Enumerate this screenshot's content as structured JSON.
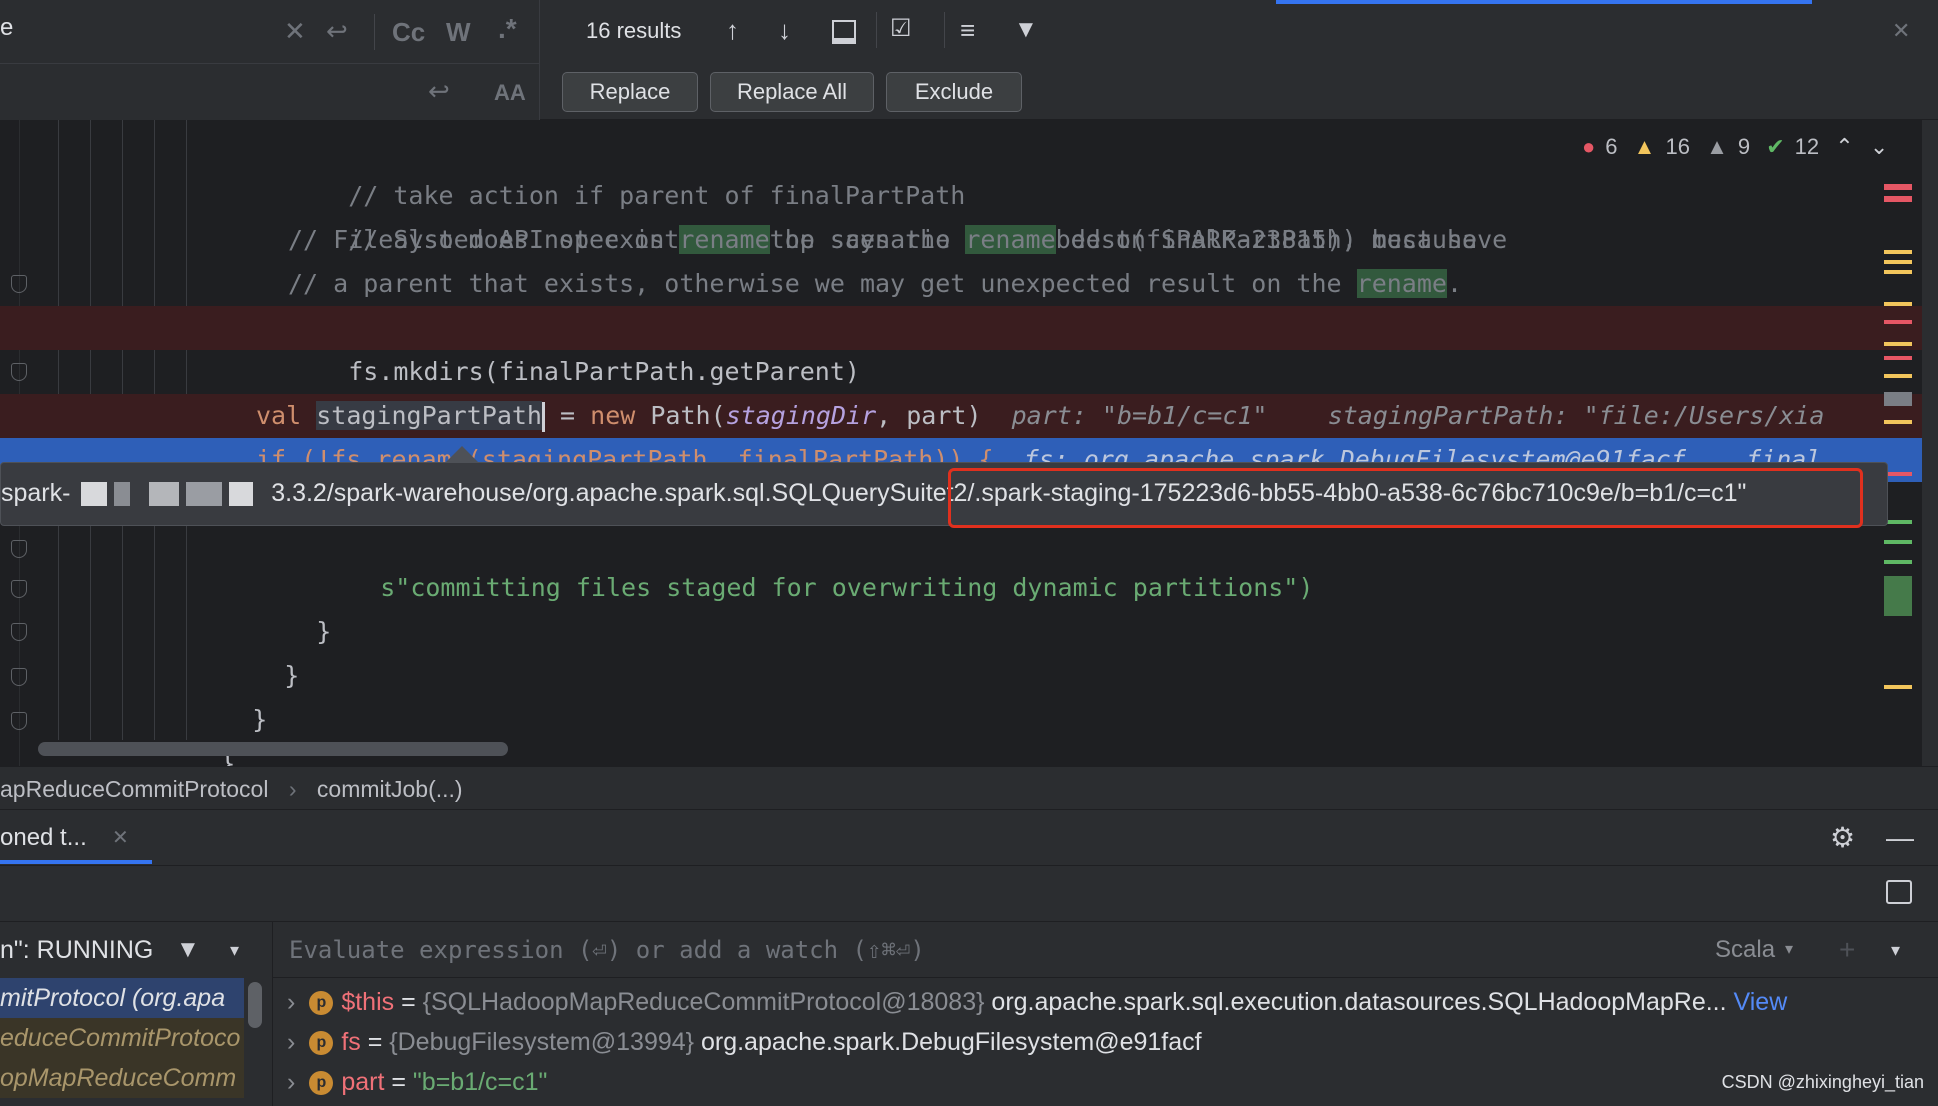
{
  "findbar": {
    "results": "16 results",
    "replace_label": "Replace",
    "replace_all_label": "Replace All",
    "exclude_label": "Exclude",
    "search_partial": "e",
    "match_case_icon": "Cc",
    "words_icon": "W",
    "regex_icon": ".*"
  },
  "editor": {
    "lines": {
      "l1": "// take action if parent of finalPartPath",
      "l2": "// also does not exist(e.g. the scenario described on SPARK-23815), because",
      "l3a": "// FileSystem API spec on ",
      "l3b": "rename",
      "l3c": " op says the ",
      "l3d": "rename",
      "l3e": " dest(finalPartPath) must have",
      "l4a": "// a parent that exists, otherwise we may get unexpected result on the ",
      "l4b": "rename",
      "l4c": ".",
      "l5": "fs.mkdirs(finalPartPath.getParent)",
      "l6": "}",
      "l7_kw": "val",
      "l7_var": "stagingPartPath",
      "l7_mid": " = ",
      "l7_new": "new",
      "l7_path": " Path(",
      "l7_param": "stagingDir",
      "l7_rest": ", part)",
      "l7_hint1": "part: \"b=b1/c=c1\"",
      "l7_hint2": "stagingPartPath: \"file:/Users/xia",
      "l8": "if (!fs.rename(stagingPartPath, finalPartPath)) {",
      "l8_hint": "fs: org.apache.spark.DebugFilesystem@e91facf    final",
      "l9": "s\"committing files staged for overwriting dynamic partitions\")",
      "l10": "}",
      "l11": "}",
      "l12": "}",
      "l13": "}"
    }
  },
  "tooltip": {
    "prefix": "spark-",
    "middle": "3.3.2/spark-warehouse/org.apache.spark.sql.SQLQuerySuite",
    "highlighted": "t2/.spark-staging-175223d6-bb55-4bb0-a538-6c76bc710c9e/b=b1/c=c1\""
  },
  "inspections": {
    "errors": "6",
    "warnings": "16",
    "weak_warnings": "9",
    "ok": "12"
  },
  "breadcrumb": {
    "class": "apReduceCommitProtocol",
    "method": "commitJob(...)"
  },
  "debug": {
    "tab_label": "oned t...",
    "thread_status": "n\": RUNNING",
    "watch_placeholder": "Evaluate expression (⏎) or add a watch (⇧⌘⏎)",
    "language": "Scala",
    "frames": [
      "mitProtocol (org.apa",
      "educeCommitProtoco",
      "opMapReduceComm"
    ],
    "variables": [
      {
        "name": "$this",
        "eq": " = ",
        "type": "{SQLHadoopMapReduceCommitProtocol@18083}",
        "value": " org.apache.spark.sql.execution.datasources.SQLHadoopMapRe...",
        "link": "View"
      },
      {
        "name": "fs",
        "eq": " = ",
        "type": "{DebugFilesystem@13994}",
        "value": " org.apache.spark.DebugFilesystem@e91facf"
      },
      {
        "name": "part",
        "eq": " = ",
        "value": "\"b=b1/c=c1\""
      }
    ]
  },
  "watermark": "CSDN @zhixingheyi_tian",
  "colors": {
    "accent": "#3574f0",
    "error": "#e55765",
    "warning": "#f2c55c",
    "ok": "#5fb865",
    "highlight_box": "#e0301e"
  }
}
